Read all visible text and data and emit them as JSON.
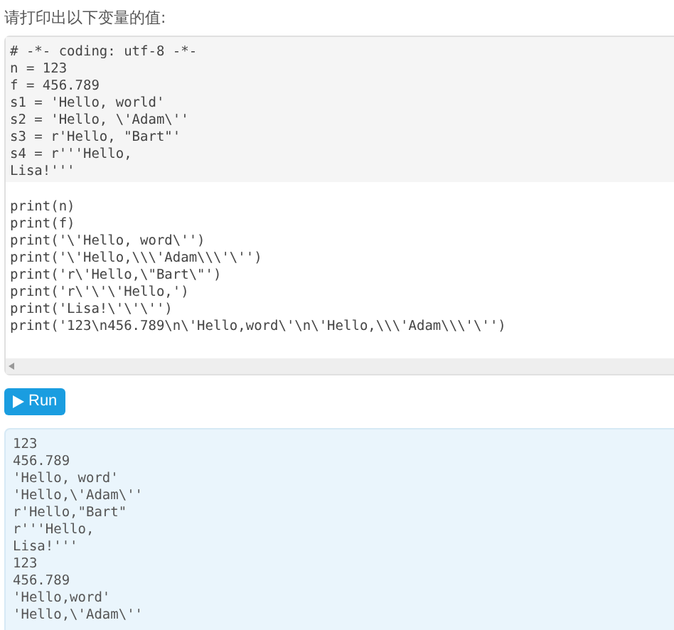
{
  "prompt": "请打印出以下变量的值:",
  "prefix_lines": [
    "# -*- coding: utf-8 -*-",
    "n = 123",
    "f = 456.789",
    "s1 = 'Hello, world'",
    "s2 = 'Hello, \\'Adam\\''",
    "s3 = r'Hello, \"Bart\"'",
    "s4 = r'''Hello,",
    "Lisa!'''"
  ],
  "editor_lines": [
    "print(n)",
    "print(f)",
    "print('\\'Hello, word\\'')",
    "print('\\'Hello,\\\\\\'Adam\\\\\\'\\'')",
    "print('r\\'Hello,\\\"Bart\\\"')",
    "print('r\\'\\'\\'Hello,')",
    "print('Lisa!\\'\\'\\'')",
    "print('123\\n456.789\\n\\'Hello,word\\'\\n\\'Hello,\\\\\\'Adam\\\\\\'\\'')"
  ],
  "run_button": {
    "label": "Run"
  },
  "output_lines": [
    "123",
    "456.789",
    "'Hello, word'",
    "'Hello,\\'Adam\\''",
    "r'Hello,\"Bart\"",
    "r'''Hello,",
    "Lisa!'''",
    "123",
    "456.789",
    "'Hello,word'",
    "'Hello,\\'Adam\\''"
  ]
}
